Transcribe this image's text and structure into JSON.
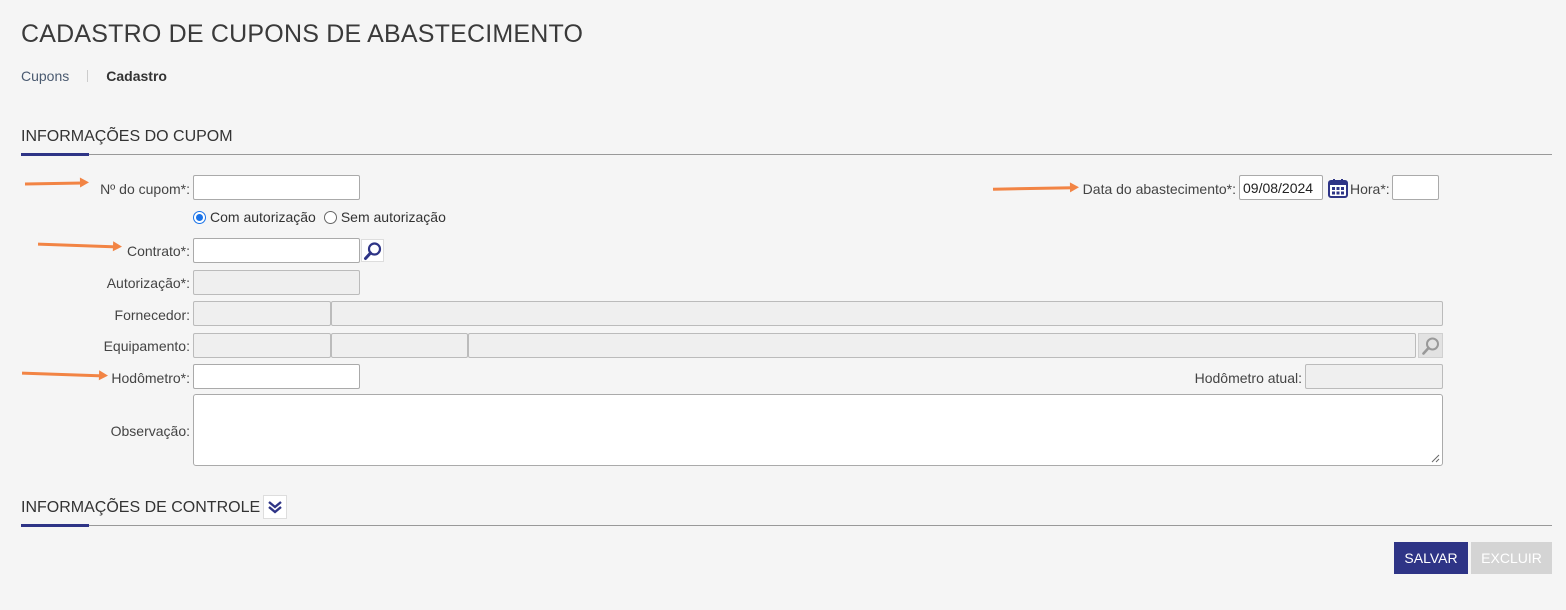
{
  "header": {
    "title": "CADASTRO DE CUPONS DE ABASTECIMENTO"
  },
  "breadcrumb": {
    "items": [
      "Cupons",
      "Cadastro"
    ]
  },
  "sections": {
    "info_cupom": "INFORMAÇÕES DO CUPOM",
    "info_controle": "INFORMAÇÕES DE CONTROLE"
  },
  "form": {
    "numero_cupom": {
      "label": "Nº do cupom*:",
      "value": ""
    },
    "data_abastecimento": {
      "label": "Data do abastecimento*:",
      "value": "09/08/2024"
    },
    "hora": {
      "label": "Hora*:",
      "value": ""
    },
    "autorizacao_opcoes": {
      "com": "Com autorização",
      "sem": "Sem autorização",
      "selected": "com"
    },
    "contrato": {
      "label": "Contrato*:",
      "value": ""
    },
    "autorizacao": {
      "label": "Autorização*:",
      "value": ""
    },
    "fornecedor": {
      "label": "Fornecedor:",
      "codigo": "",
      "nome": ""
    },
    "equipamento": {
      "label": "Equipamento:",
      "codigo": "",
      "campo2": "",
      "descricao": ""
    },
    "hodometro": {
      "label": "Hodômetro*:",
      "value": ""
    },
    "hodometro_atual": {
      "label": "Hodômetro atual:",
      "value": ""
    },
    "observacao": {
      "label": "Observação:",
      "value": ""
    }
  },
  "actions": {
    "save": "SALVAR",
    "delete": "EXCLUIR"
  },
  "icons": {
    "calendar": "calendar-icon",
    "search": "search-icon",
    "expand": "double-chevron-down-icon"
  },
  "colors": {
    "primary": "#2e3486",
    "annotation_arrow": "#f28444",
    "radio_selected": "#1a73e8"
  }
}
